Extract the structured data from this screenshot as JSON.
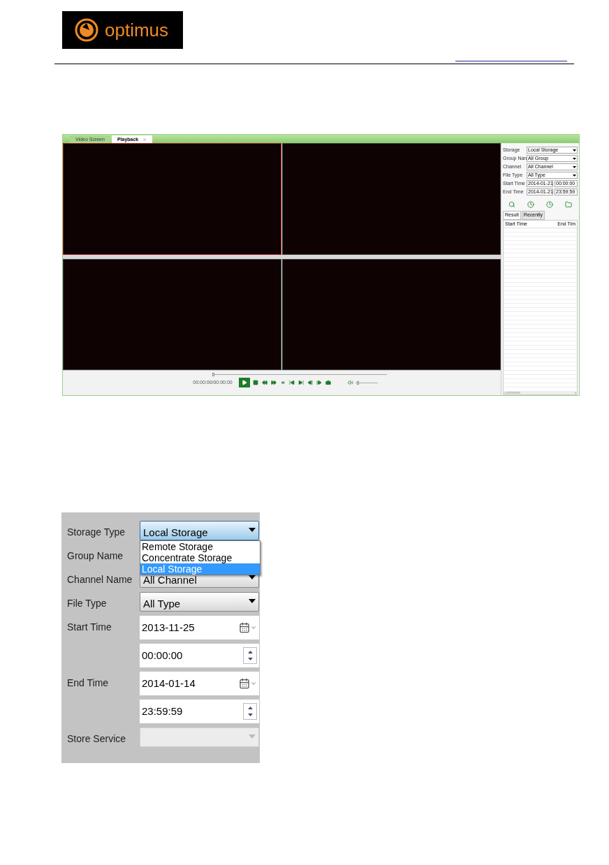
{
  "header": {
    "logo_text": "optimus"
  },
  "playback_window": {
    "tabs": [
      {
        "label": "Video Screen",
        "selected": false,
        "closable": false
      },
      {
        "label": "Playback",
        "selected": true,
        "closable": true
      }
    ],
    "video_cells": [
      {
        "selected": true
      },
      {
        "selected": false
      },
      {
        "selected": false
      },
      {
        "selected": false
      }
    ],
    "timeline": {
      "level": 0
    },
    "time_reading": "00:00:00/00:00:00",
    "controls": [
      {
        "kind": "play",
        "active": true
      },
      {
        "kind": "stop",
        "active": false
      },
      {
        "kind": "slow",
        "active": false
      },
      {
        "kind": "fast",
        "active": false
      },
      {
        "kind": "back",
        "active": false
      },
      {
        "kind": "first",
        "active": false
      },
      {
        "kind": "last",
        "active": false
      },
      {
        "kind": "frame-back",
        "active": false
      },
      {
        "kind": "frame-forward",
        "active": false
      },
      {
        "kind": "snapshot",
        "active": false
      }
    ],
    "volume": {
      "level": 0.08
    },
    "search_panel": {
      "fields": [
        {
          "label": "Storage",
          "kind": "select",
          "value": "Local Storage"
        },
        {
          "label": "Group Nan",
          "kind": "select",
          "value": "All Group"
        },
        {
          "label": "Channel",
          "kind": "select",
          "value": "All Channel"
        },
        {
          "label": "File Type",
          "kind": "select",
          "value": "All Type"
        },
        {
          "label": "Start Time",
          "kind": "datetime",
          "value": "2014-01-21",
          "time": "00:00:00"
        },
        {
          "label": "End Time",
          "kind": "datetime",
          "value": "2014-01-21",
          "time": "23:59:59"
        }
      ],
      "actions": [
        {
          "kind": "search"
        },
        {
          "kind": "clock-in"
        },
        {
          "kind": "clock-out"
        },
        {
          "kind": "folder"
        }
      ],
      "tabs": [
        {
          "label": "Result",
          "selected": true
        },
        {
          "label": "Recently",
          "selected": false
        }
      ],
      "columns": [
        "Start Time",
        "End Tim"
      ]
    }
  },
  "search_form": {
    "rows": [
      {
        "label": "Storage Type",
        "kind": "select",
        "value": "Local Storage",
        "open": true,
        "disabled": false
      },
      {
        "label": "Group Name",
        "kind": "covered"
      },
      {
        "label": "Channel Name",
        "kind": "select",
        "value": "All Channel",
        "open": false,
        "disabled": false
      },
      {
        "label": "File Type",
        "kind": "select",
        "value": "All Type",
        "open": false,
        "disabled": false
      },
      {
        "label": "Start Time",
        "kind": "date",
        "value": "2013-11-25"
      },
      {
        "kind": "time",
        "value": "00:00:00"
      },
      {
        "label": "End Time",
        "kind": "date",
        "value": "2014-01-14"
      },
      {
        "kind": "time",
        "value": "23:59:59"
      },
      {
        "label": "Store Service",
        "kind": "select",
        "disabled": true
      }
    ],
    "dropdown_options": [
      {
        "label": "Remote Storage",
        "selected": false
      },
      {
        "label": "Concentrate Storage",
        "selected": false
      },
      {
        "label": "Local Storage",
        "selected": true
      }
    ]
  }
}
